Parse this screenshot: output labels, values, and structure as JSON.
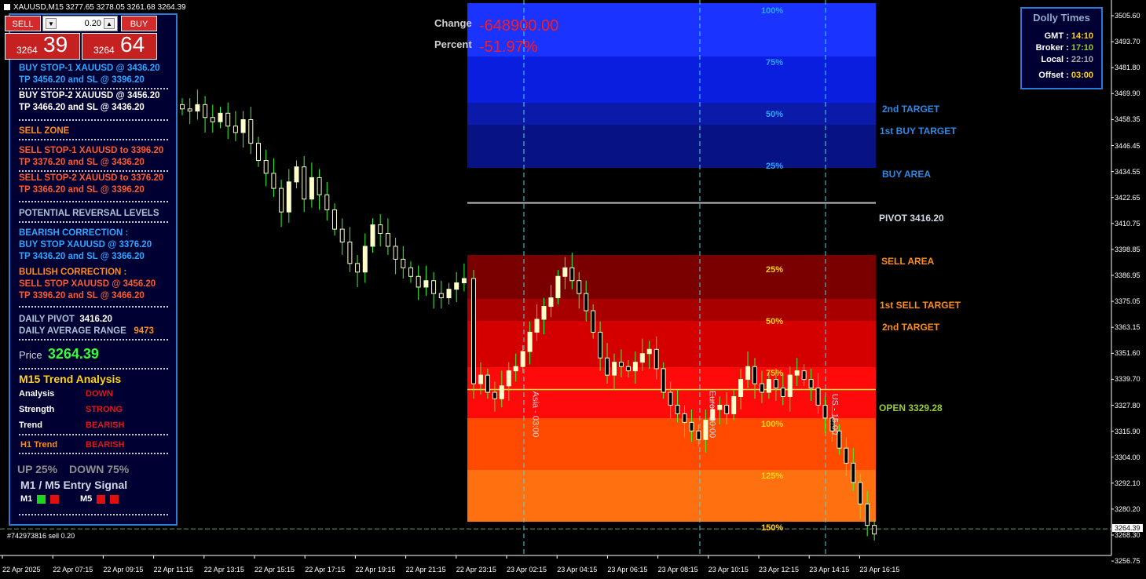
{
  "chart_title": "XAUUSD,M15  3277.65 3278.05 3261.68 3264.39",
  "trade_panel": {
    "sell_label": "SELL",
    "buy_label": "BUY",
    "lot_size": "0.20",
    "sell_price_small": "3264",
    "sell_price_big": "39",
    "buy_price_small": "3264",
    "buy_price_big": "64"
  },
  "info_panel": {
    "buy_stop_1": "BUY STOP-1  XAUUSD  @  3436.20",
    "buy_stop_1_tp": "TP 3456.20  and SL @  3396.20",
    "buy_stop_2": "BUY STOP-2  XAUUSD  @  3456.20",
    "buy_stop_2_tp": "TP 3466.20  and SL @  3436.20",
    "sell_zone": "SELL ZONE",
    "sell_stop_1": "SELL STOP-1  XAUUSD to 3396.20",
    "sell_stop_1_tp": "TP 3376.20  and SL @  3436.20",
    "sell_stop_2": "SELL STOP-2  XAUUSD to 3376.20",
    "sell_stop_2_tp": "TP 3366.20  and SL @  3396.20",
    "reversal_levels": "POTENTIAL REVERSAL LEVELS",
    "bearish_correction": "BEARISH CORRECTION :",
    "bearish_buy_stop": "BUY STOP XAUUSD  @  3376.20",
    "bearish_tp": "TP 3436.20  and SL @  3366.20",
    "bullish_correction": "BULLISH CORRECTION :",
    "bullish_sell_stop": "SELL STOP XAUUSD  @  3456.20",
    "bullish_tp": "TP 3396.20  and SL @  3466.20",
    "daily_pivot_label": "DAILY PIVOT",
    "daily_pivot_value": "3416.20",
    "dar_label": "DAILY AVERAGE RANGE",
    "dar_value": "9473",
    "price_label": "Price",
    "price_value": "3264.39",
    "trend_title": "M15 Trend Analysis",
    "analysis_label": "Analysis",
    "analysis_value": "DOWN",
    "strength_label": "Strength",
    "strength_value": "STRONG",
    "trend_label": "Trend",
    "trend_value": "BEARISH",
    "h1_label": "H1 Trend",
    "h1_value": "BEARISH",
    "up_pct": "UP 25%",
    "down_pct": "DOWN 75%",
    "entry_title": "M1 /  M5 Entry Signal",
    "m1_label": "M1",
    "m5_label": "M5"
  },
  "dolly_times": {
    "title": "Dolly Times",
    "gmt_label": "GMT :",
    "gmt_value": "14:10",
    "broker_label": "Broker :",
    "broker_value": "17:10",
    "local_label": "Local :",
    "local_value": "22:10",
    "offset_label": "Offset :",
    "offset_value": "03:00"
  },
  "change": {
    "change_label": "Change",
    "change_value": "-648900.00",
    "percent_label": "Percent",
    "percent_value": "-51.97%"
  },
  "zone_percent_labels": {
    "buy_100": "100%",
    "buy_75": "75%",
    "buy_50": "50%",
    "buy_25": "25%",
    "sell_25": "25%",
    "sell_50": "50%",
    "sell_75": "75%",
    "sell_100": "100%",
    "sell_125": "125%",
    "sell_150": "150%"
  },
  "level_labels": {
    "second_target_up": "2nd TARGET",
    "first_buy_target": "1st BUY TARGET",
    "buy_area": "BUY AREA",
    "pivot": "PIVOT 3416.20",
    "sell_area": "SELL AREA",
    "first_sell_target": "1st SELL TARGET",
    "second_target_down": "2nd TARGET",
    "open": "OPEN 3329.28"
  },
  "session_labels": {
    "asia": "Asia - 03:00",
    "euro": "Euro - 10:00",
    "us": "US - 15:00"
  },
  "order_line_label": "#742973816 sell 0.20",
  "price_axis": {
    "ticks": [
      "3505.60",
      "3493.70",
      "3481.80",
      "3469.90",
      "3458.35",
      "3446.45",
      "3434.55",
      "3422.65",
      "3410.75",
      "3398.85",
      "3386.95",
      "3375.05",
      "3363.15",
      "3351.60",
      "3339.70",
      "3327.80",
      "3315.90",
      "3304.00",
      "3292.10",
      "3280.20",
      "3268.30",
      "3256.75"
    ],
    "current_price": "3264.39"
  },
  "time_axis": {
    "ticks": [
      "22 Apr 2025",
      "22 Apr 07:15",
      "22 Apr 09:15",
      "22 Apr 11:15",
      "22 Apr 13:15",
      "22 Apr 15:15",
      "22 Apr 17:15",
      "22 Apr 19:15",
      "22 Apr 21:15",
      "22 Apr 23:15",
      "23 Apr 02:15",
      "23 Apr 04:15",
      "23 Apr 06:15",
      "23 Apr 08:15",
      "23 Apr 10:15",
      "23 Apr 12:15",
      "23 Apr 14:15",
      "23 Apr 16:15"
    ]
  },
  "colors": {
    "bull_candle": "#ffffcc",
    "bear_candle": "#ffffcc",
    "wick": "#33ff33",
    "panel_border": "#2b7bd6",
    "sell_button": "#d32b2b"
  },
  "chart_data": {
    "type": "candlestick",
    "symbol": "XAUUSD",
    "timeframe": "M15",
    "ylim": [
      3252,
      3510
    ],
    "levels": {
      "pivot": 3416.2,
      "open": 3329.28,
      "current": 3264.39
    },
    "close_path": [
      3460,
      3459,
      3462,
      3456,
      3454,
      3458,
      3452,
      3449,
      3455,
      3444,
      3436,
      3430,
      3423,
      3412,
      3426,
      3433,
      3418,
      3428,
      3420,
      3413,
      3404,
      3398,
      3388,
      3384,
      3396,
      3406,
      3402,
      3396,
      3390,
      3386,
      3382,
      3377,
      3380,
      3374,
      3372,
      3376,
      3379,
      3381,
      3332,
      3336,
      3328,
      3325,
      3331,
      3338,
      3340,
      3347,
      3356,
      3362,
      3368,
      3372,
      3382,
      3386,
      3380,
      3374,
      3366,
      3356,
      3344,
      3336,
      3342,
      3340,
      3338,
      3342,
      3346,
      3348,
      3339,
      3328,
      3322,
      3318,
      3314,
      3310,
      3306,
      3315,
      3320,
      3322,
      3318,
      3326,
      3334,
      3340,
      3332,
      3328,
      3334,
      3330,
      3326,
      3336,
      3338,
      3334,
      3330,
      3322,
      3316,
      3310,
      3302,
      3295,
      3286,
      3276,
      3266,
      3262
    ]
  }
}
